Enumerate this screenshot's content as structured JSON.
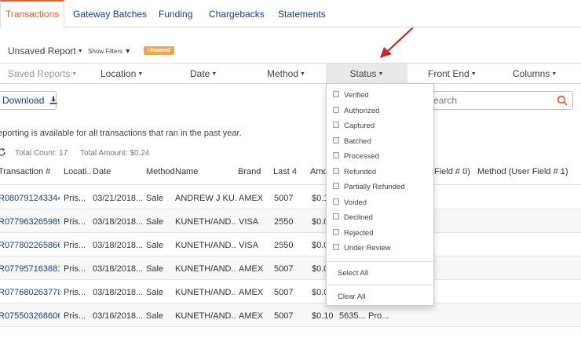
{
  "tabs": [
    "Transactions",
    "Gateway Batches",
    "Funding",
    "Chargebacks",
    "Statements"
  ],
  "report": {
    "name": "Unsaved Report",
    "show_filters": "Show Filters",
    "badge": "Unsaved"
  },
  "filters": {
    "saved_reports": "Saved Reports",
    "location": "Location",
    "date": "Date",
    "method": "Method",
    "status": "Status",
    "front_end": "Front End",
    "columns": "Columns"
  },
  "toolbar": {
    "download_label": "Download",
    "search_placeholder": "earch"
  },
  "info": {
    "reporting_note": "eporting is available for all transactions that ran in the past year.",
    "total_count": "Total Count: 17",
    "total_amount": "Total Amount: $0.24"
  },
  "table": {
    "headers": {
      "transaction": "Transaction #",
      "location": "Locati...",
      "date": "Date",
      "method": "Method",
      "name": "Name",
      "brand": "Brand",
      "last4": "Last 4",
      "amount": "Amo",
      "user_field_0": "Field # 0)",
      "user_field_1": "Method (User Field # 1)"
    },
    "rows": [
      {
        "id": "R080791243344",
        "loc": "Pris...",
        "date": "03/21/2018...",
        "method": "Sale",
        "name": "ANDREW J KU...",
        "brand": "AMEX",
        "last4": "5007",
        "amount": "$0.1",
        "extra1": "",
        "extra2": ""
      },
      {
        "id": "R077963265989",
        "loc": "Pris...",
        "date": "03/18/2018...",
        "method": "Sale",
        "name": "KUNETH/AND...",
        "brand": "VISA",
        "last4": "2550",
        "amount": "$0.0",
        "extra1": "",
        "extra2": ""
      },
      {
        "id": "R077802265866",
        "loc": "Pris...",
        "date": "03/18/2018...",
        "method": "Sale",
        "name": "KUNETH/AND...",
        "brand": "VISA",
        "last4": "2550",
        "amount": "$0.0",
        "extra1": "",
        "extra2": ""
      },
      {
        "id": "R077957163881",
        "loc": "Pris...",
        "date": "03/18/2018...",
        "method": "Sale",
        "name": "KUNETH/AND...",
        "brand": "AMEX",
        "last4": "5007",
        "amount": "$0.0",
        "extra1": "",
        "extra2": ""
      },
      {
        "id": "R077680263778",
        "loc": "Pris...",
        "date": "03/18/2018...",
        "method": "Sale",
        "name": "KUNETH/AND...",
        "brand": "AMEX",
        "last4": "5007",
        "amount": "$0.0",
        "extra1": "",
        "extra2": ""
      },
      {
        "id": "R075503268606",
        "loc": "Pris...",
        "date": "03/16/2018...",
        "method": "Sale",
        "name": "KUNETH/AND...",
        "brand": "AMEX",
        "last4": "5007",
        "amount": "$0.10",
        "extra1": "5635...",
        "extra2": "Pro..."
      }
    ]
  },
  "status_dropdown": {
    "options": [
      "Verified",
      "Authorized",
      "Captured",
      "Batched",
      "Processed",
      "Refunded",
      "Partially Refunded",
      "Voided",
      "Declined",
      "Rejected",
      "Under Review"
    ],
    "select_all": "Select All",
    "clear_all": "Clear All"
  },
  "colors": {
    "accent": "#e0642a",
    "link": "#1c3d7a",
    "badge": "#f0a841",
    "arrow": "#c62828"
  }
}
